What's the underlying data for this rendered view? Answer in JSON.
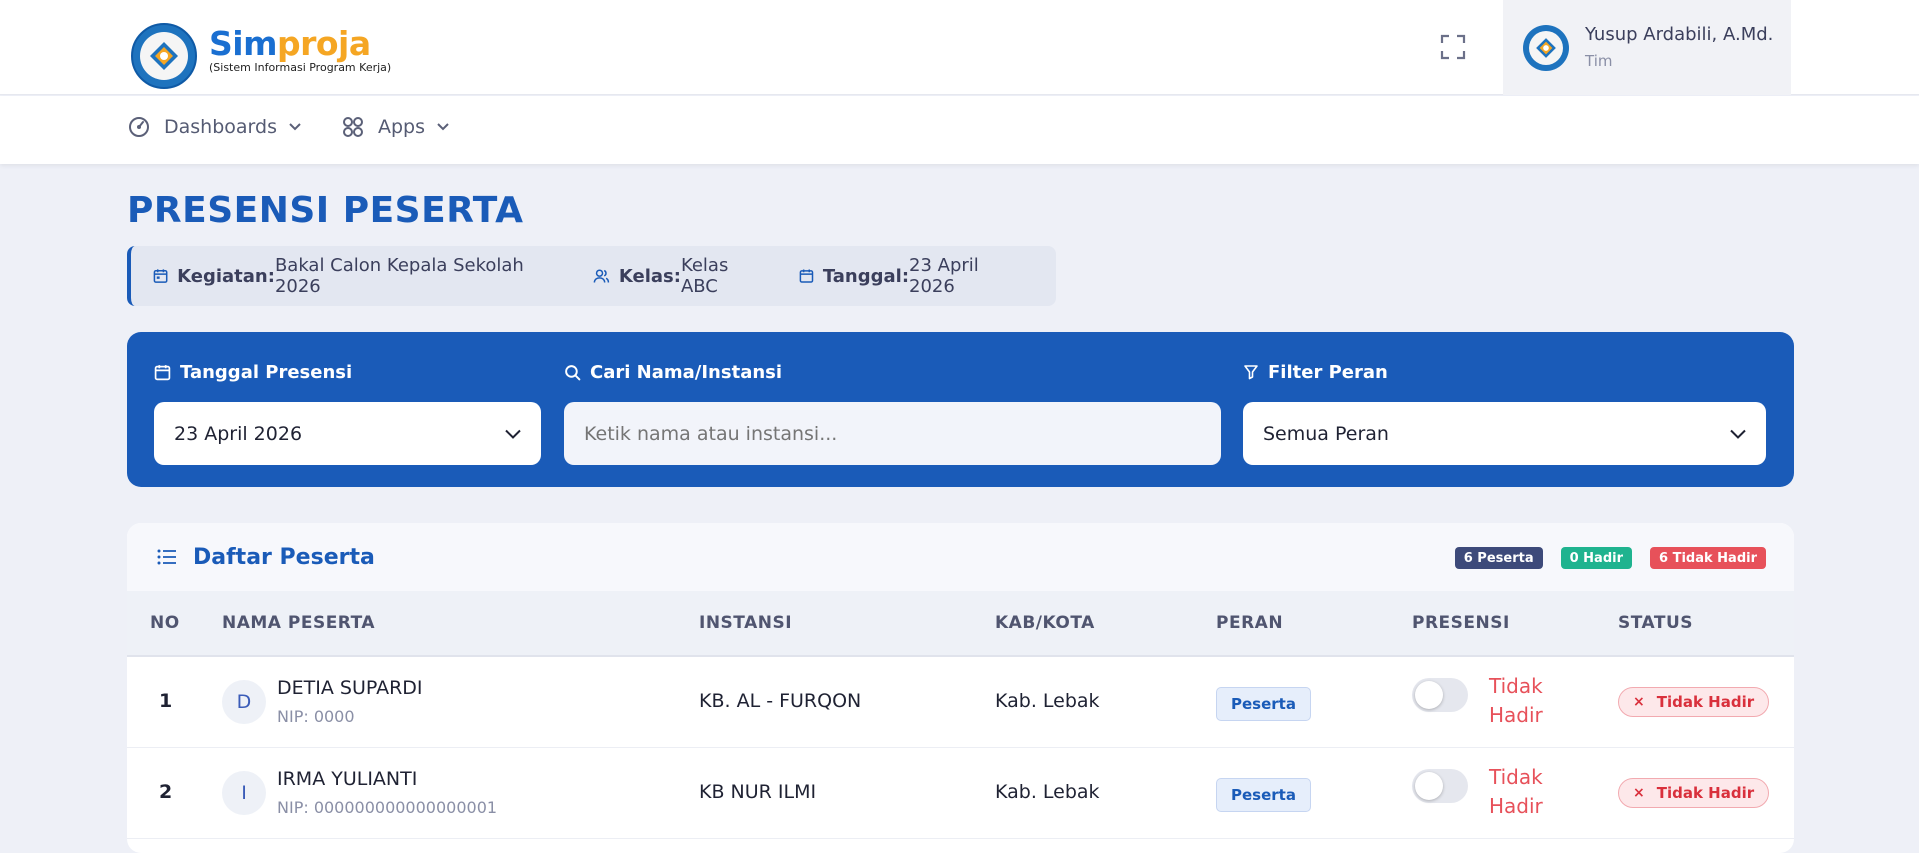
{
  "brand": {
    "name_part1": "Sim",
    "name_part2": "proja",
    "subtitle": "(Sistem Informasi Program Kerja)"
  },
  "user": {
    "name": "Yusup Ardabili, A.Md.",
    "role": "Tim"
  },
  "nav": {
    "items": [
      {
        "label": "Dashboards",
        "icon": "gauge-icon"
      },
      {
        "label": "Apps",
        "icon": "grid-icon"
      }
    ]
  },
  "page": {
    "title": "PRESENSI PESERTA"
  },
  "info": {
    "kegiatan_label": "Kegiatan:",
    "kegiatan_value": "Bakal Calon Kepala Sekolah 2026",
    "kelas_label": "Kelas:",
    "kelas_value": "Kelas ABC",
    "tanggal_label": "Tanggal:",
    "tanggal_value": "23 April 2026"
  },
  "filters": {
    "date_label": "Tanggal Presensi",
    "date_value": "23 April 2026",
    "search_label": "Cari Nama/Instansi",
    "search_placeholder": "Ketik nama atau instansi...",
    "role_label": "Filter Peran",
    "role_value": "Semua Peran"
  },
  "table": {
    "title": "Daftar Peserta",
    "badges": {
      "total": "6 Peserta",
      "hadir": "0 Hadir",
      "tidak_hadir": "6 Tidak Hadir"
    },
    "colors": {
      "total": "#3d4a7a",
      "hadir": "#1fb38f",
      "tidak_hadir": "#e7515a"
    },
    "columns": {
      "no": "NO",
      "nama": "NAMA PESERTA",
      "instansi": "INSTANSI",
      "kab": "KAB/KOTA",
      "peran": "PERAN",
      "presensi": "PRESENSI",
      "status": "STATUS"
    },
    "rows": [
      {
        "no": "1",
        "initial": "D",
        "name": "DETIA SUPARDI",
        "nip": "NIP: 0000",
        "instansi": "KB. AL - FURQON",
        "kab": "Kab. Lebak",
        "peran": "Peserta",
        "presensi": "Tidak Hadir",
        "status_mark": "×",
        "status": "Tidak Hadir"
      },
      {
        "no": "2",
        "initial": "I",
        "name": "IRMA YULIANTI",
        "nip": "NIP: 000000000000000001",
        "instansi": "KB NUR ILMI",
        "kab": "Kab. Lebak",
        "peran": "Peserta",
        "presensi": "Tidak Hadir",
        "status_mark": "×",
        "status": "Tidak Hadir"
      }
    ]
  }
}
